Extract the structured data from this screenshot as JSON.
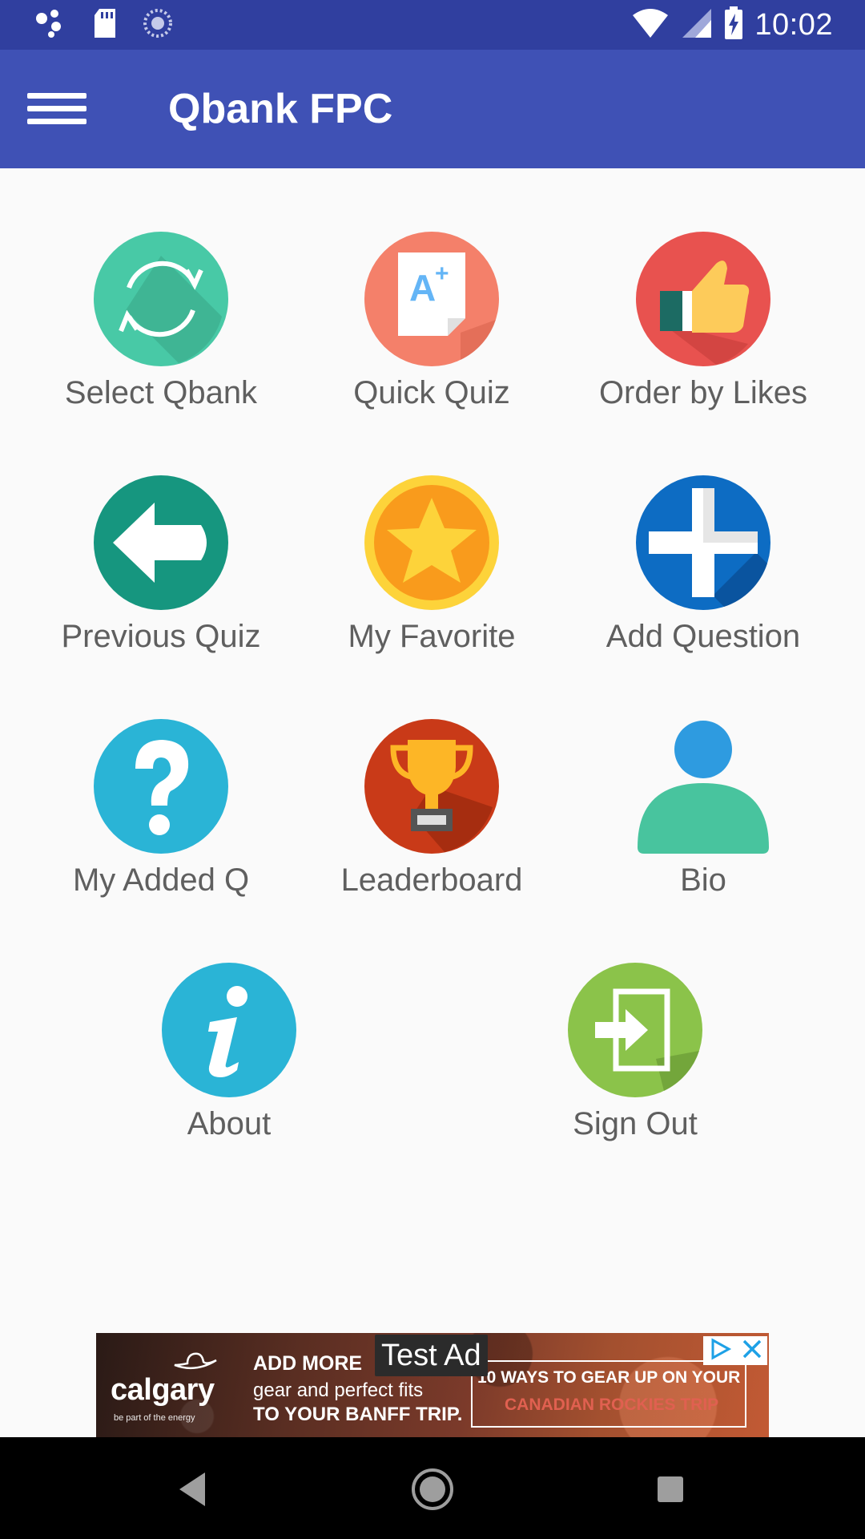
{
  "status_bar": {
    "time": "10:02",
    "icons": [
      "assistant-icon",
      "sd-card-icon",
      "sync-spinner-icon",
      "wifi-icon",
      "cell-signal-icon",
      "battery-charging-icon"
    ]
  },
  "app_bar": {
    "title": "Qbank FPC",
    "menu_icon": "hamburger-menu-icon"
  },
  "menu": {
    "items": [
      {
        "label": "Select Qbank",
        "icon": "refresh-cycle-icon",
        "color": "#48c9a6"
      },
      {
        "label": "Quick Quiz",
        "icon": "a-plus-document-icon",
        "color": "#f4806a"
      },
      {
        "label": "Order by Likes",
        "icon": "thumbs-up-icon",
        "color": "#e8524f"
      },
      {
        "label": "Previous Quiz",
        "icon": "arrow-left-icon",
        "color": "#16967f"
      },
      {
        "label": "My Favorite",
        "icon": "star-icon",
        "color": "#fdb626"
      },
      {
        "label": "Add Question",
        "icon": "plus-icon",
        "color": "#0d6cc3"
      },
      {
        "label": "My Added Q",
        "icon": "question-mark-icon",
        "color": "#2ab4d6"
      },
      {
        "label": "Leaderboard",
        "icon": "trophy-icon",
        "color": "#c93a18"
      },
      {
        "label": "Bio",
        "icon": "user-icon",
        "color": "#48c49e"
      },
      {
        "label": "About",
        "icon": "info-icon",
        "color": "#2ab4d6"
      },
      {
        "label": "Sign Out",
        "icon": "sign-out-icon",
        "color": "#8bc34a"
      }
    ]
  },
  "ad": {
    "label": "Test Ad",
    "brand": "calgary",
    "brand_tagline": "be part of the energy",
    "line1": "ADD MORE",
    "line2": "gear and perfect fits",
    "line3": "TO YOUR BANFF TRIP.",
    "box_line1": "10 WAYS TO GEAR UP ON YOUR",
    "box_line2": "CANADIAN ROCKIES TRIP"
  },
  "nav_bar": {
    "buttons": [
      "back-icon",
      "home-icon",
      "recents-icon"
    ]
  }
}
